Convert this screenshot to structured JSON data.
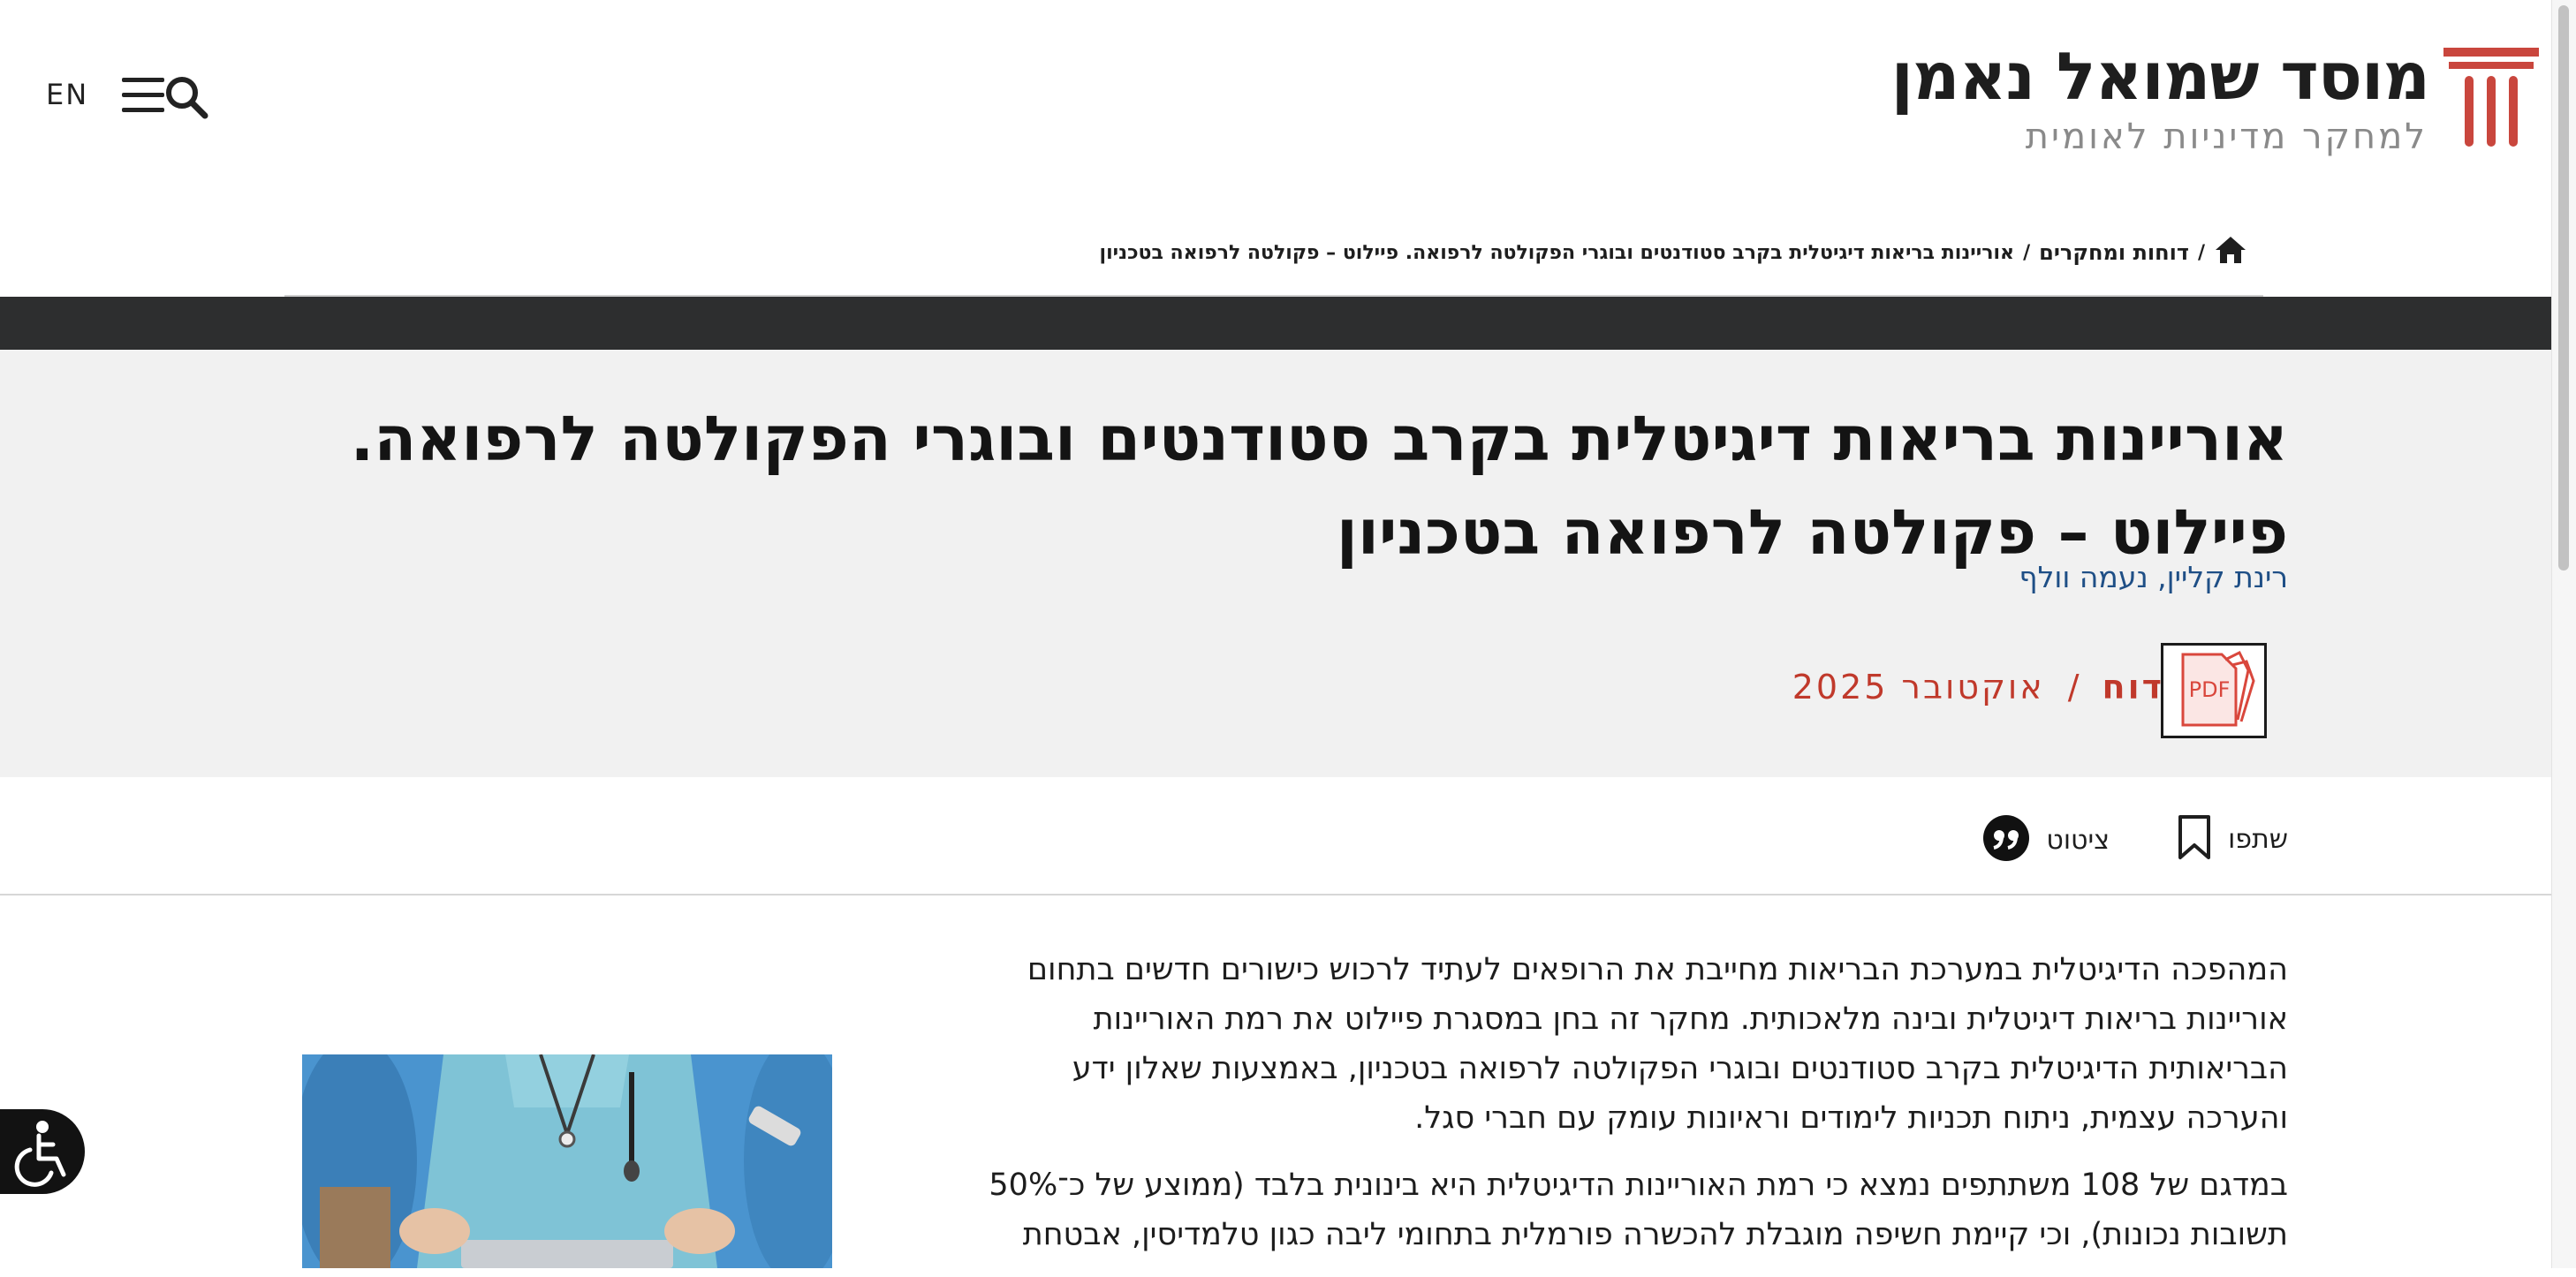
{
  "header": {
    "lang_switch": "EN",
    "logo_title": "מוסד שמואל נאמן",
    "logo_subtitle": "למחקר מדיניות לאומית"
  },
  "breadcrumb": {
    "separator_1": "/",
    "section": "דוחות ומחקרים",
    "separator_2": "/",
    "current": "אוריינות בריאות דיגיטלית בקרב סטודנטים ובוגרי הפקולטה לרפואה. פיילוט – פקולטה לרפואה בטכניון"
  },
  "article": {
    "title_line1": "אוריינות בריאות דיגיטלית בקרב סטודנטים ובוגרי הפקולטה לרפואה.",
    "title_line2": "פיילוט – פקולטה לרפואה בטכניון",
    "authors": "רינת קליין, נעמה וולף",
    "type": "דוח",
    "meta_separator": "/",
    "date": "אוקטובר 2025",
    "pdf_label": "PDF"
  },
  "actions": {
    "share_label": "שתפו",
    "cite_label": "ציטוט"
  },
  "body": {
    "para1_line1": "המהפכה הדיגיטלית במערכת הבריאות מחייבת את הרופאים לעתיד לרכוש כישורים חדשים בתחום",
    "para1_line2": "אוריינות בריאות דיגיטלית ובינה מלאכותית. מחקר זה בחן במסגרת פיילוט את רמת האוריינות",
    "para1_line3": "הבריאותית הדיגיטלית בקרב סטודנטים ובוגרי הפקולטה לרפואה בטכניון, באמצעות שאלון ידע",
    "para1_line4": "והערכה עצמית, ניתוח תכניות לימודים וראיונות עומק עם חברי סגל.",
    "para2_line1": "במדגם של 108 משתתפים נמצא כי רמת האוריינות הדיגיטלית היא בינונית בלבד (ממוצע של כ־50%",
    "para2_line2": "תשובות נכונות), וכי קיימת חשיפה מוגבלת להכשרה פורמלית בתחומי ליבה כגון טלמדיסין, אבטחת"
  },
  "colors": {
    "accent_red": "#c0392b",
    "link_blue": "#1f4f86",
    "dark_band": "#2d2e2f",
    "title_bg": "#f1f1f1"
  }
}
